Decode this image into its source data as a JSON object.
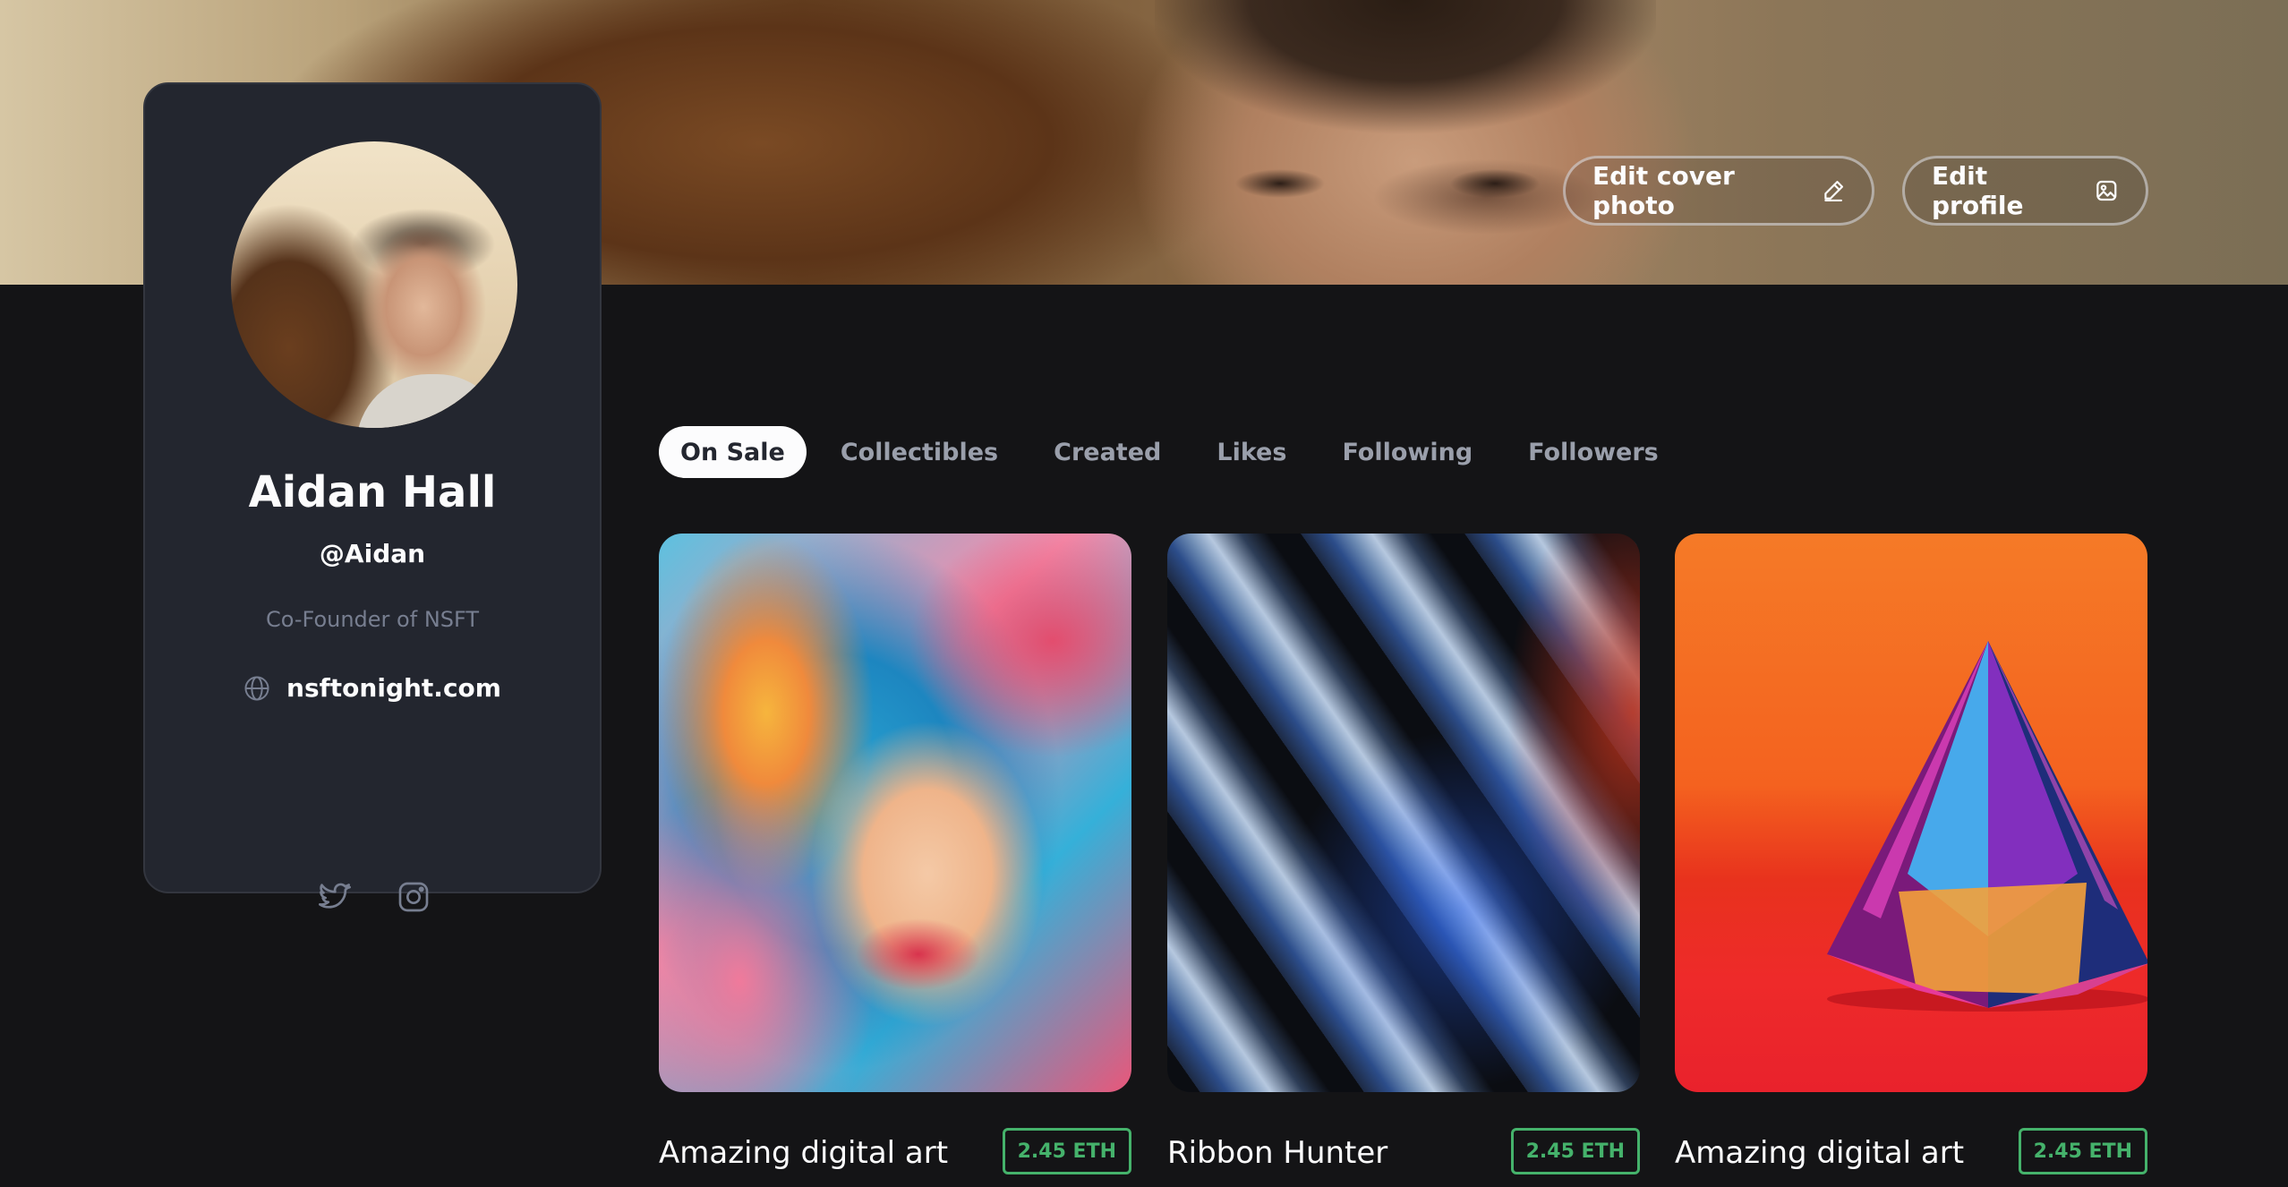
{
  "cover": {
    "edit_cover_label": "Edit cover photo",
    "edit_profile_label": "Edit profile"
  },
  "profile": {
    "name": "Aidan Hall",
    "handle": "@Aidan",
    "bio": "Co-Founder of NSFT",
    "website": "nsftonight.com",
    "socials": [
      "twitter-icon",
      "instagram-icon"
    ]
  },
  "tabs": [
    {
      "label": "On Sale",
      "active": true
    },
    {
      "label": "Collectibles",
      "active": false
    },
    {
      "label": "Created",
      "active": false
    },
    {
      "label": "Likes",
      "active": false
    },
    {
      "label": "Following",
      "active": false
    },
    {
      "label": "Followers",
      "active": false
    }
  ],
  "items": [
    {
      "title": "Amazing digital art",
      "price": "2.45 ETH"
    },
    {
      "title": "Ribbon Hunter",
      "price": "2.45 ETH"
    },
    {
      "title": "Amazing digital art",
      "price": "2.45 ETH"
    }
  ],
  "colors": {
    "background": "#141416",
    "card": "#23262f",
    "price_green": "#45b26b",
    "muted_text": "#777e90"
  }
}
